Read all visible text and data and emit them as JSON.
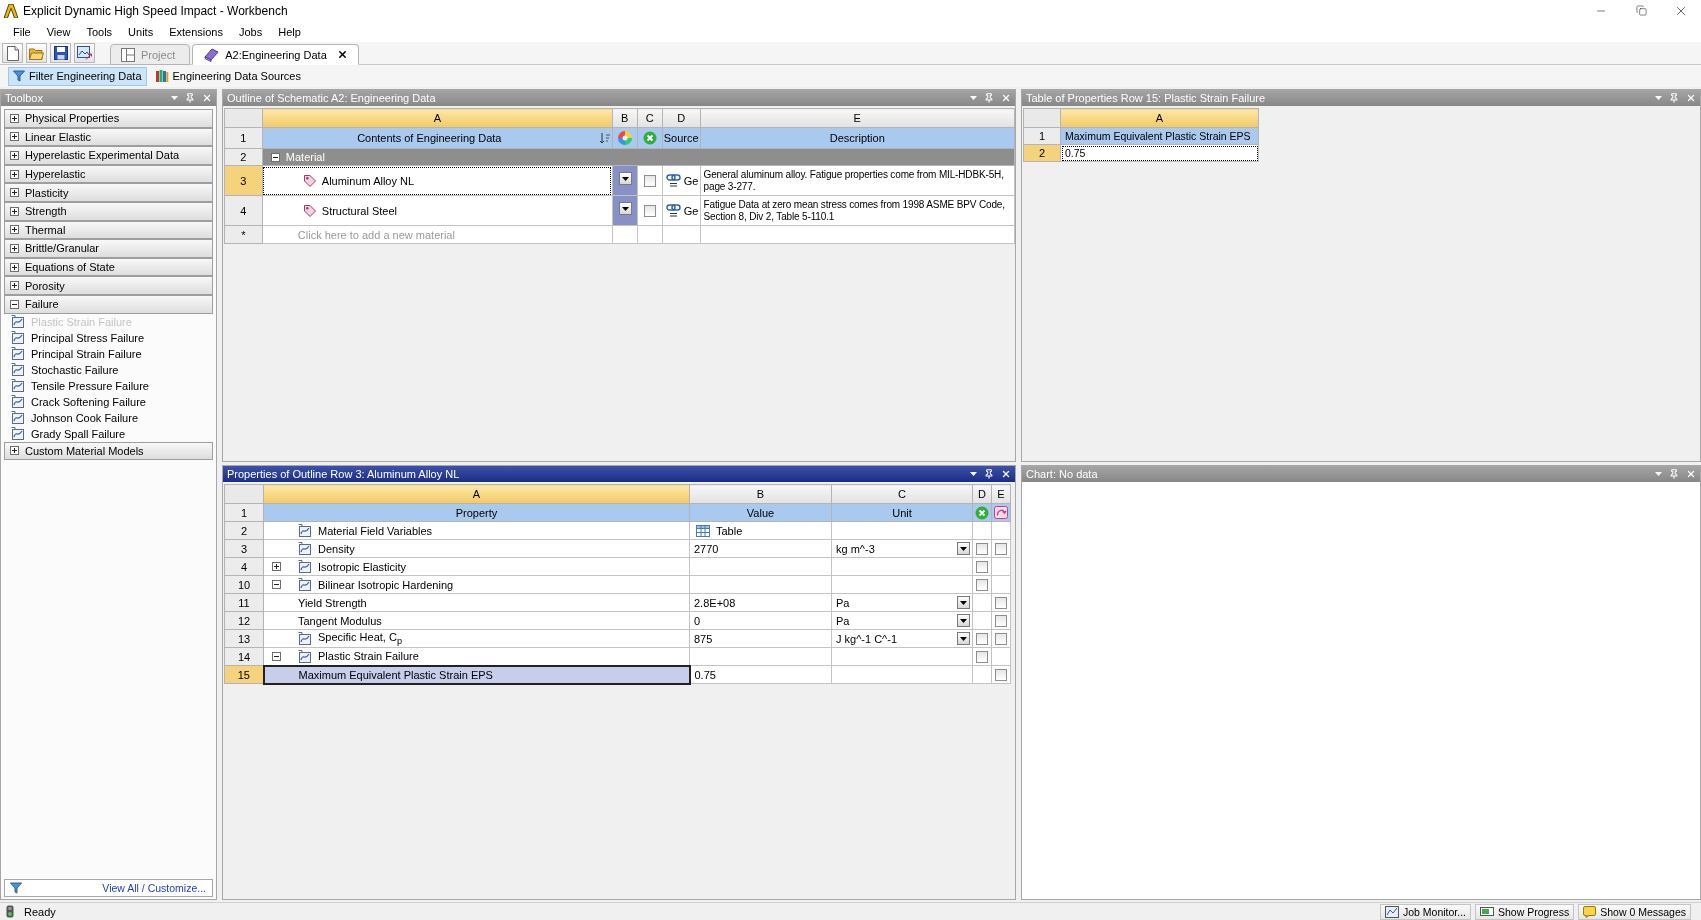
{
  "window": {
    "title": "Explicit Dynamic High Speed Impact - Workbench"
  },
  "menu": [
    "File",
    "View",
    "Tools",
    "Units",
    "Extensions",
    "Jobs",
    "Help"
  ],
  "tabs": [
    {
      "label": "Project",
      "selected": false,
      "kind": "project"
    },
    {
      "label": "A2:Engineering Data",
      "selected": true,
      "kind": "engineering_data"
    }
  ],
  "filter_bar": [
    {
      "label": "Filter Engineering Data",
      "selected": true,
      "kind": "filter"
    },
    {
      "label": "Engineering Data Sources",
      "selected": false,
      "kind": "sources"
    }
  ],
  "toolbox": {
    "title": "Toolbox",
    "active": false,
    "groups": [
      {
        "label": "Physical Properties",
        "expanded": false
      },
      {
        "label": "Linear Elastic",
        "expanded": false
      },
      {
        "label": "Hyperelastic Experimental Data",
        "expanded": false
      },
      {
        "label": "Hyperelastic",
        "expanded": false
      },
      {
        "label": "Plasticity",
        "expanded": false
      },
      {
        "label": "Strength",
        "expanded": false
      },
      {
        "label": "Thermal",
        "expanded": false
      },
      {
        "label": "Brittle/Granular",
        "expanded": false
      },
      {
        "label": "Equations of State",
        "expanded": false
      },
      {
        "label": "Porosity",
        "expanded": false
      },
      {
        "label": "Failure",
        "expanded": true,
        "children": [
          {
            "label": "Plastic Strain Failure",
            "disabled": true
          },
          {
            "label": "Principal Stress Failure",
            "disabled": false
          },
          {
            "label": "Principal Strain Failure",
            "disabled": false
          },
          {
            "label": "Stochastic Failure",
            "disabled": false
          },
          {
            "label": "Tensile Pressure Failure",
            "disabled": false
          },
          {
            "label": "Crack Softening Failure",
            "disabled": false
          },
          {
            "label": "Johnson Cook Failure",
            "disabled": false
          },
          {
            "label": "Grady Spall Failure",
            "disabled": false
          }
        ]
      },
      {
        "label": "Custom Material Models",
        "expanded": false
      }
    ],
    "footer_link": "View All / Customize..."
  },
  "outline": {
    "title": "Outline of Schematic A2: Engineering Data",
    "active": false,
    "columns": [
      {
        "label": "A",
        "selected": true
      },
      {
        "label": "B",
        "selected": false
      },
      {
        "label": "C",
        "selected": false
      },
      {
        "label": "D",
        "selected": false
      },
      {
        "label": "E",
        "selected": false
      }
    ],
    "header_row": {
      "row": "1",
      "contents": "Contents of Engineering Data",
      "source": "Source",
      "description": "Description"
    },
    "group": {
      "row": "2",
      "label": "Material",
      "expanded": true,
      "children": [
        {
          "row": "3",
          "name": "Aluminum Alloy NL",
          "selected": true,
          "checked": false,
          "source": "Ge",
          "description": "General aluminum alloy. Fatigue properties come from MIL-HDBK-5H, page 3-277."
        },
        {
          "row": "4",
          "name": "Structural Steel",
          "selected": false,
          "checked": false,
          "source": "Ge",
          "description": "Fatigue Data at zero mean stress comes from 1998 ASME BPV Code, Section 8, Div 2, Table 5-110.1"
        }
      ]
    },
    "new_row": {
      "row": "*",
      "placeholder": "Click here to add a new material"
    }
  },
  "table_of_properties": {
    "title": "Table of Properties Row 15: Plastic Strain Failure",
    "active": false,
    "columns": [
      {
        "label": "A",
        "selected": true
      }
    ],
    "rows": [
      {
        "row": "1",
        "kind": "header",
        "text": "Maximum Equivalent Plastic Strain EPS",
        "selected": false
      },
      {
        "row": "2",
        "kind": "value",
        "text": "0.75",
        "selected": true
      }
    ]
  },
  "properties": {
    "title": "Properties of Outline Row 3: Aluminum Alloy NL",
    "active": true,
    "columns": [
      {
        "label": "A",
        "selected": true
      },
      {
        "label": "B",
        "selected": false
      },
      {
        "label": "C",
        "selected": false
      },
      {
        "label": "D",
        "selected": false
      },
      {
        "label": "E",
        "selected": false
      }
    ],
    "header_row": {
      "row": "1",
      "property": "Property",
      "value": "Value",
      "unit": "Unit"
    },
    "rows": [
      {
        "row": "2",
        "kind": "table",
        "name": "Material Field Variables",
        "value": "Table",
        "selected": false
      },
      {
        "row": "3",
        "kind": "property",
        "name": "Density",
        "value": "2770",
        "unit": "kg m^-3",
        "check_d": false,
        "check_e": false,
        "selected": false
      },
      {
        "row": "4",
        "kind": "property",
        "name": "Isotropic Elasticity",
        "expanded": false,
        "check_d": false,
        "selected": false
      },
      {
        "row": "10",
        "kind": "property",
        "name": "Bilinear Isotropic Hardening",
        "expanded": true,
        "check_d": false,
        "selected": false,
        "children": [
          {
            "row": "11",
            "kind": "parameter",
            "name": "Yield Strength",
            "value": "2.8E+08",
            "unit": "Pa",
            "check_e": false,
            "selected": false
          },
          {
            "row": "12",
            "kind": "parameter",
            "name": "Tangent Modulus",
            "value": "0",
            "unit": "Pa",
            "check_e": false,
            "selected": false
          }
        ]
      },
      {
        "row": "13",
        "kind": "property",
        "name": "Specific Heat, C$_{p}$",
        "value": "875",
        "unit": "J kg^-1 C^-1",
        "check_d": false,
        "check_e": false,
        "selected": false
      },
      {
        "row": "14",
        "kind": "property",
        "name": "Plastic Strain Failure",
        "expanded": true,
        "check_d": false,
        "selected": false,
        "children": [
          {
            "row": "15",
            "kind": "parameter",
            "name": "Maximum Equivalent Plastic Strain EPS",
            "value": "0.75",
            "check_e": false,
            "selected": true
          }
        ]
      }
    ]
  },
  "chart": {
    "title": "Chart: No data",
    "active": false
  },
  "status_bar": {
    "text": "Ready",
    "buttons": [
      {
        "label": "Job Monitor...",
        "kind": "monitor"
      },
      {
        "label": "Show Progress",
        "kind": "progress"
      },
      {
        "label": "Show 0 Messages",
        "kind": "messages"
      }
    ]
  }
}
